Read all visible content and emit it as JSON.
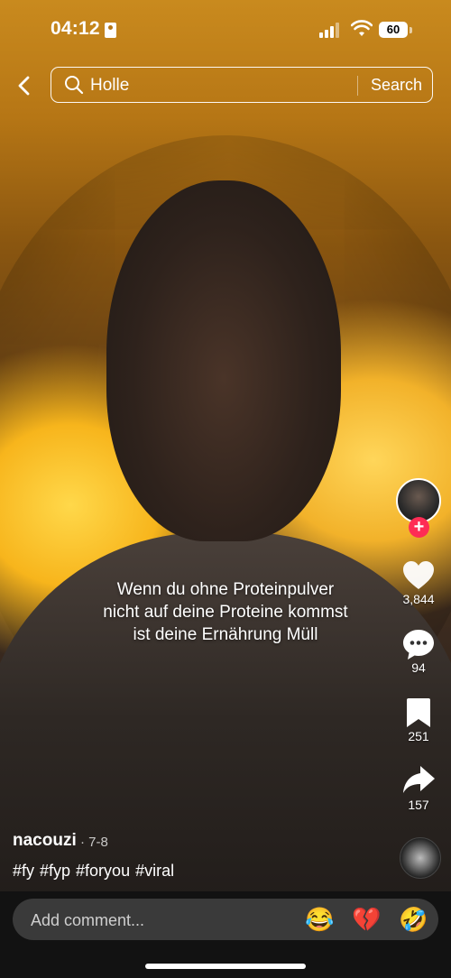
{
  "status": {
    "time": "04:12",
    "battery": "60"
  },
  "search": {
    "query": "Holle",
    "button": "Search"
  },
  "video": {
    "caption": "Wenn du ohne Proteinpulver nicht auf deine Proteine kommst ist deine Ernährung Müll"
  },
  "rail": {
    "follow": "+",
    "likes": "3,844",
    "comments": "94",
    "saves": "251",
    "shares": "157"
  },
  "post": {
    "username": "nacouzi",
    "date": "· 7-8",
    "hashtags": "#fy #fyp #foryou #viral"
  },
  "comment_bar": {
    "placeholder": "Add comment...",
    "emojis": [
      "😂",
      "💔",
      "🤣"
    ]
  },
  "colors": {
    "follow": "#fe2c55",
    "comment_bg": "#3a3a3a"
  }
}
